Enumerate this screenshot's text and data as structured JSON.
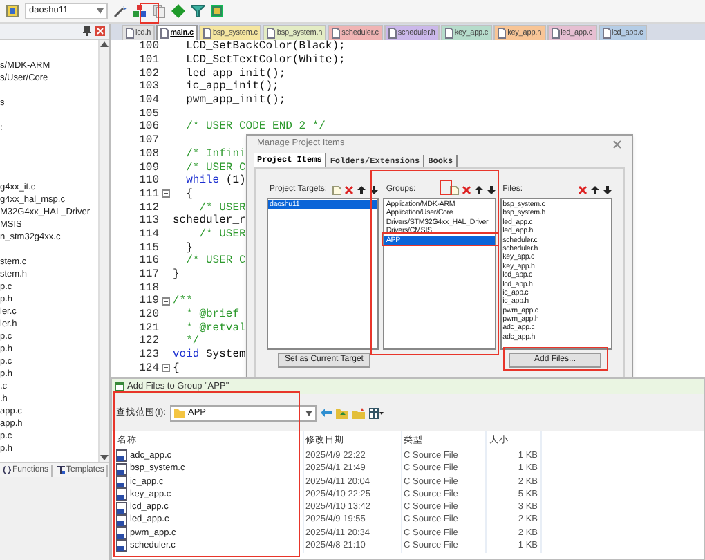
{
  "toolbar": {
    "target": "daoshu11"
  },
  "project_panel": {
    "items": [
      "s/MDK-ARM",
      "s/User/Core",
      "s",
      ":",
      "g4xx_it.c",
      "g4xx_hal_msp.c",
      "M32G4xx_HAL_Driver",
      "MSIS",
      "n_stm32g4xx.c",
      "stem.c",
      "stem.h",
      "p.c",
      "p.h",
      "ler.c",
      "ler.h",
      "p.c",
      "p.h",
      "p.c",
      "p.h",
      ".c",
      ".h",
      "app.c",
      "app.h",
      "p.c",
      "p.h"
    ],
    "tabs": [
      {
        "label": "Functions"
      },
      {
        "label": "Templates"
      }
    ]
  },
  "editor_tabs": [
    {
      "label": "lcd.h",
      "selected": false,
      "color": "#e2e2e2"
    },
    {
      "label": "main.c",
      "selected": true,
      "color": "#ffffff"
    },
    {
      "label": "bsp_system.c",
      "selected": false,
      "color": "#f5e6a0"
    },
    {
      "label": "bsp_system.h",
      "selected": false,
      "color": "#e3ecc4"
    },
    {
      "label": "scheduler.c",
      "selected": false,
      "color": "#f0b4b4"
    },
    {
      "label": "scheduler.h",
      "selected": false,
      "color": "#cbb8ea"
    },
    {
      "label": "key_app.c",
      "selected": false,
      "color": "#b6dccb"
    },
    {
      "label": "key_app.h",
      "selected": false,
      "color": "#f8c596"
    },
    {
      "label": "led_app.c",
      "selected": false,
      "color": "#e6bfd2"
    },
    {
      "label": "lcd_app.c",
      "selected": false,
      "color": "#b5cde6"
    }
  ],
  "code_lines": [
    {
      "number": "100",
      "fold": false,
      "tokens": [
        {
          "kind": "plain",
          "text": "  LCD_SetBackColor(Black);"
        }
      ]
    },
    {
      "number": "101",
      "fold": false,
      "tokens": [
        {
          "kind": "plain",
          "text": "  LCD_SetTextColor(White);"
        }
      ]
    },
    {
      "number": "102",
      "fold": false,
      "tokens": [
        {
          "kind": "plain",
          "text": "  led_app_init();"
        }
      ]
    },
    {
      "number": "103",
      "fold": false,
      "tokens": [
        {
          "kind": "plain",
          "text": "  ic_app_init();"
        }
      ]
    },
    {
      "number": "104",
      "fold": false,
      "tokens": [
        {
          "kind": "plain",
          "text": "  pwm_app_init();"
        }
      ]
    },
    {
      "number": "105",
      "fold": false
    },
    {
      "number": "106",
      "fold": false,
      "tokens": [
        {
          "kind": "comment",
          "text": "  /* USER CODE END 2 */"
        }
      ]
    },
    {
      "number": "107",
      "fold": false
    },
    {
      "number": "108",
      "fold": false,
      "tokens": [
        {
          "kind": "comment",
          "text": "  /* Infini"
        }
      ]
    },
    {
      "number": "109",
      "fold": false,
      "tokens": [
        {
          "kind": "comment",
          "text": "  /* USER C"
        }
      ]
    },
    {
      "number": "110",
      "fold": false,
      "tokens": [
        {
          "kind": "keyword",
          "text": "  while"
        },
        {
          "kind": "plain",
          "text": " (1)"
        }
      ]
    },
    {
      "number": "111",
      "fold": true,
      "tokens": [
        {
          "kind": "plain",
          "text": "  {"
        }
      ]
    },
    {
      "number": "112",
      "fold": false,
      "tokens": [
        {
          "kind": "comment",
          "text": "    /* USER"
        }
      ]
    },
    {
      "number": "113",
      "fold": false,
      "tokens": [
        {
          "kind": "plain",
          "text": "scheduler_r"
        }
      ]
    },
    {
      "number": "114",
      "fold": false,
      "tokens": [
        {
          "kind": "comment",
          "text": "    /* USER"
        }
      ]
    },
    {
      "number": "115",
      "fold": false,
      "tokens": [
        {
          "kind": "plain",
          "text": "  }"
        }
      ]
    },
    {
      "number": "116",
      "fold": false,
      "tokens": [
        {
          "kind": "comment",
          "text": "  /* USER C"
        }
      ]
    },
    {
      "number": "117",
      "fold": false,
      "tokens": [
        {
          "kind": "plain",
          "text": "}"
        }
      ]
    },
    {
      "number": "118",
      "fold": false
    },
    {
      "number": "119",
      "fold": true,
      "tokens": [
        {
          "kind": "comment",
          "text": "/**"
        }
      ]
    },
    {
      "number": "120",
      "fold": false,
      "tokens": [
        {
          "kind": "comment",
          "text": "  * @brief"
        }
      ]
    },
    {
      "number": "121",
      "fold": false,
      "tokens": [
        {
          "kind": "comment",
          "text": "  * @retval"
        }
      ]
    },
    {
      "number": "122",
      "fold": false,
      "tokens": [
        {
          "kind": "comment",
          "text": "  */"
        }
      ]
    },
    {
      "number": "123",
      "fold": false,
      "tokens": [
        {
          "kind": "keyword",
          "text": "void"
        },
        {
          "kind": "plain",
          "text": " System"
        }
      ]
    },
    {
      "number": "124",
      "fold": true,
      "tokens": [
        {
          "kind": "plain",
          "text": "{"
        }
      ]
    }
  ],
  "manage_dialog": {
    "title": "Manage Project Items",
    "tabs": [
      {
        "label": "Project Items",
        "selected": true
      },
      {
        "label": "Folders/Extensions",
        "selected": false
      },
      {
        "label": "Books",
        "selected": false
      }
    ],
    "panels": [
      {
        "label": "Project Targets:",
        "tools": [
          {
            "kind": "new"
          },
          {
            "kind": "delete"
          },
          {
            "kind": "up"
          },
          {
            "kind": "down"
          }
        ],
        "items": [
          {
            "text": "daoshu11",
            "selected": true
          }
        ]
      },
      {
        "label": "Groups:",
        "tools": [
          {
            "kind": "new"
          },
          {
            "kind": "delete"
          },
          {
            "kind": "up"
          },
          {
            "kind": "down"
          }
        ],
        "items": [
          {
            "text": "Application/MDK-ARM",
            "selected": false
          },
          {
            "text": "Application/User/Core",
            "selected": false
          },
          {
            "text": "Drivers/STM32G4xx_HAL_Driver",
            "selected": false
          },
          {
            "text": "Drivers/CMSIS",
            "selected": false
          },
          {
            "text": "APP",
            "selected": true
          }
        ]
      },
      {
        "label": "Files:",
        "tools": [
          {
            "kind": "delete"
          },
          {
            "kind": "up"
          },
          {
            "kind": "down"
          }
        ],
        "items": [
          {
            "text": "bsp_system.c",
            "selected": false
          },
          {
            "text": "bsp_system.h",
            "selected": false
          },
          {
            "text": "led_app.c",
            "selected": false
          },
          {
            "text": "led_app.h",
            "selected": false
          },
          {
            "text": "scheduler.c",
            "selected": false
          },
          {
            "text": "scheduler.h",
            "selected": false
          },
          {
            "text": "key_app.c",
            "selected": false
          },
          {
            "text": "key_app.h",
            "selected": false
          },
          {
            "text": "lcd_app.c",
            "selected": false
          },
          {
            "text": "lcd_app.h",
            "selected": false
          },
          {
            "text": "ic_app.c",
            "selected": false
          },
          {
            "text": "ic_app.h",
            "selected": false
          },
          {
            "text": "pwm_app.c",
            "selected": false
          },
          {
            "text": "pwm_app.h",
            "selected": false
          },
          {
            "text": "adc_app.c",
            "selected": false
          },
          {
            "text": "adc_app.h",
            "selected": false
          }
        ]
      }
    ],
    "buttons": [
      "Set as Current Target",
      "Add Files..."
    ]
  },
  "add_dialog": {
    "title": "Add Files to Group \"APP\"",
    "look_in_label": "查找范围(I):",
    "look_in": "APP",
    "columns": [
      "名称",
      "修改日期",
      "类型",
      "大小"
    ],
    "rows": [
      {
        "name": "adc_app.c",
        "modified": "2025/4/9 22:22",
        "type": "C Source File",
        "size": "1 KB"
      },
      {
        "name": "bsp_system.c",
        "modified": "2025/4/1 21:49",
        "type": "C Source File",
        "size": "1 KB"
      },
      {
        "name": "ic_app.c",
        "modified": "2025/4/11 20:04",
        "type": "C Source File",
        "size": "2 KB"
      },
      {
        "name": "key_app.c",
        "modified": "2025/4/10 22:25",
        "type": "C Source File",
        "size": "5 KB"
      },
      {
        "name": "lcd_app.c",
        "modified": "2025/4/10 13:42",
        "type": "C Source File",
        "size": "3 KB"
      },
      {
        "name": "led_app.c",
        "modified": "2025/4/9 19:55",
        "type": "C Source File",
        "size": "2 KB"
      },
      {
        "name": "pwm_app.c",
        "modified": "2025/4/11 20:34",
        "type": "C Source File",
        "size": "2 KB"
      },
      {
        "name": "scheduler.c",
        "modified": "2025/4/8 21:10",
        "type": "C Source File",
        "size": "1 KB"
      }
    ]
  }
}
